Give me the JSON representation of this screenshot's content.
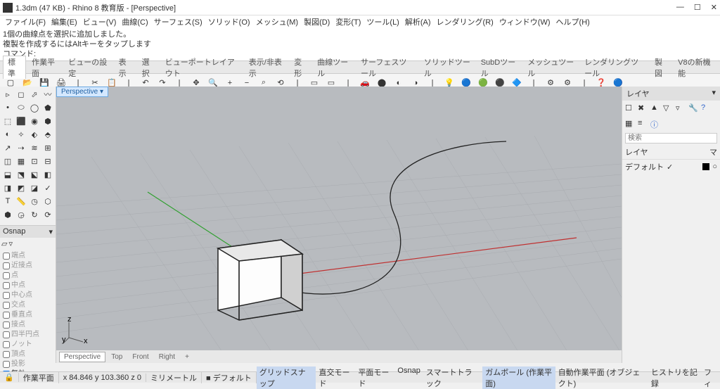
{
  "title": "1.3dm (47 KB) - Rhino 8 教育版 - [Perspective]",
  "menu": [
    "ファイル(F)",
    "編集(E)",
    "ビュー(V)",
    "曲線(C)",
    "サーフェス(S)",
    "ソリッド(O)",
    "メッシュ(M)",
    "製図(D)",
    "変形(T)",
    "ツール(L)",
    "解析(A)",
    "レンダリング(R)",
    "ウィンドウ(W)",
    "ヘルプ(H)"
  ],
  "cmd_history": [
    "1個の曲線点を選択に追加しました。",
    "複製を作成するにはAltキーをタップします"
  ],
  "cmd_prompt": "コマンド:",
  "tab_row": [
    "標準",
    "作業平面",
    "ビューの設定",
    "表示",
    "選択",
    "ビューポートレイアウト",
    "表示/非表示",
    "変形",
    "曲線ツール",
    "サーフェスツール",
    "ソリッドツール",
    "SubDツール",
    "メッシュツール",
    "レンダリングツール",
    "製図",
    "V8の新機能"
  ],
  "viewport_label": "Perspective ▾",
  "viewport_tabs": [
    "Perspective",
    "Top",
    "Front",
    "Right",
    "+"
  ],
  "osnap": {
    "title": "Osnap",
    "items": [
      "端点",
      "近接点",
      "点",
      "中点",
      "中心点",
      "交点",
      "垂直点",
      "接点",
      "四半円点",
      "ノット",
      "頂点",
      "投影"
    ],
    "last": "無効"
  },
  "layers": {
    "title": "レイヤ",
    "search_ph": "検索",
    "col_layer": "レイヤ",
    "col_mat": "マ",
    "rows": [
      {
        "name": "デフォルト",
        "chk": "✓"
      }
    ]
  },
  "status": {
    "cplane": "作業平面",
    "coords": "x 84.846  y 103.360  z 0",
    "units": "ミリメートル",
    "layer": "デフォルト",
    "right": [
      "グリッドスナップ",
      "直交モード",
      "平面モード",
      "Osnap",
      "スマートトラック",
      "ガムボール (作業平面)",
      "自動作業平面 (オブジェクト)",
      "ヒストリを記録",
      "フィ"
    ]
  }
}
